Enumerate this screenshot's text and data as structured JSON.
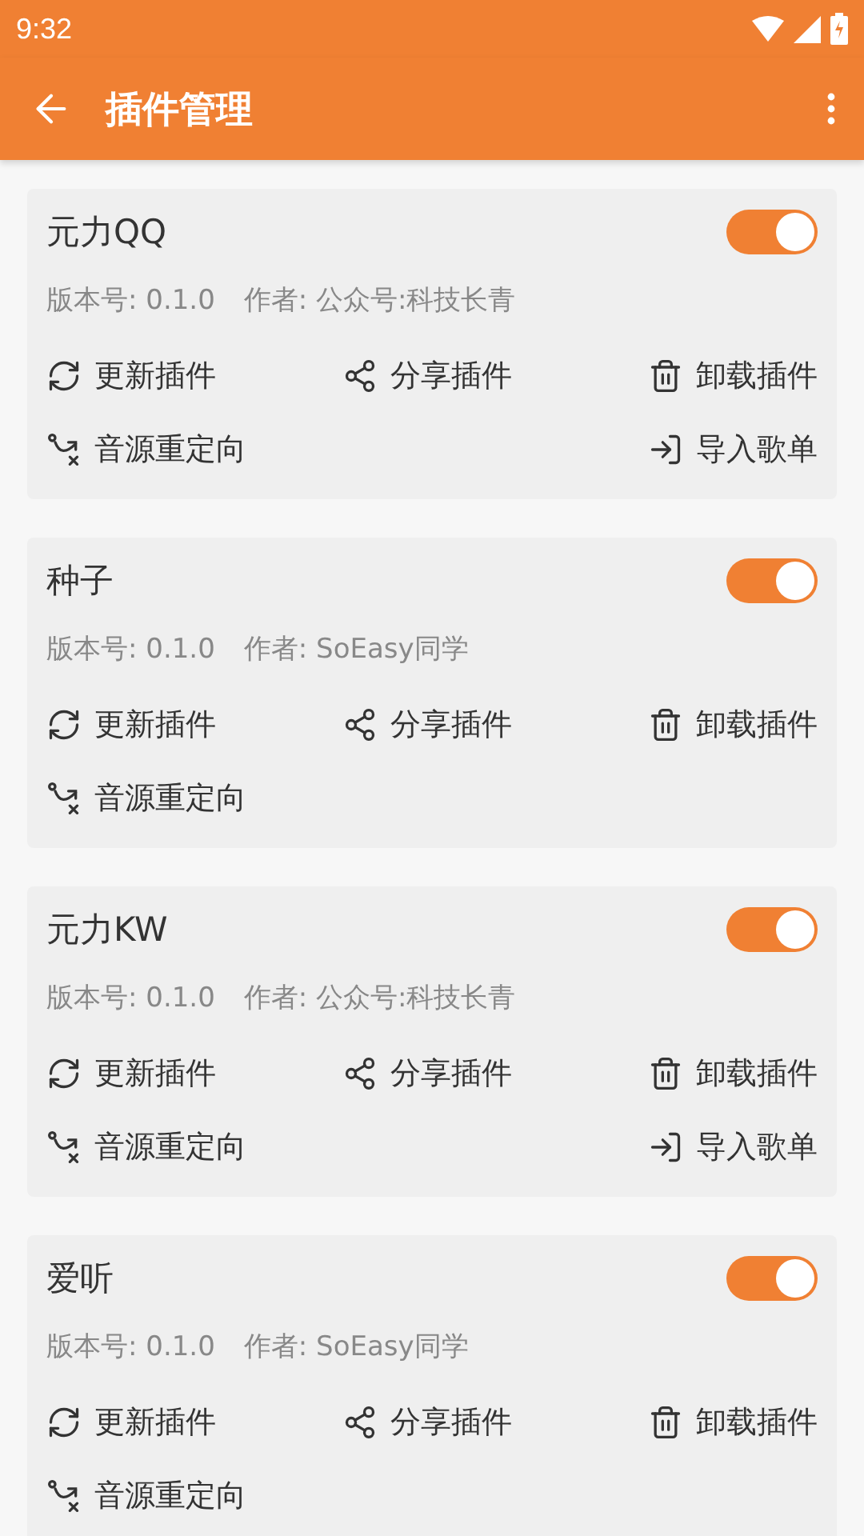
{
  "status_bar": {
    "time": "9:32"
  },
  "app_bar": {
    "title": "插件管理"
  },
  "plugins": [
    {
      "name": "元力QQ",
      "enabled": true,
      "version": "版本号: 0.1.0",
      "author": "作者: 公众号:科技长青",
      "actions": [
        {
          "kind": "update",
          "label": "更新插件"
        },
        {
          "kind": "share",
          "label": "分享插件"
        },
        {
          "kind": "uninstall",
          "label": "卸载插件"
        },
        {
          "kind": "redirect",
          "label": "音源重定向"
        },
        {
          "kind": "import",
          "label": "导入歌单"
        }
      ]
    },
    {
      "name": "种子",
      "enabled": true,
      "version": "版本号: 0.1.0",
      "author": "作者: SoEasy同学",
      "actions": [
        {
          "kind": "update",
          "label": "更新插件"
        },
        {
          "kind": "share",
          "label": "分享插件"
        },
        {
          "kind": "uninstall",
          "label": "卸载插件"
        },
        {
          "kind": "redirect",
          "label": "音源重定向"
        }
      ]
    },
    {
      "name": "元力KW",
      "enabled": true,
      "version": "版本号: 0.1.0",
      "author": "作者: 公众号:科技长青",
      "actions": [
        {
          "kind": "update",
          "label": "更新插件"
        },
        {
          "kind": "share",
          "label": "分享插件"
        },
        {
          "kind": "uninstall",
          "label": "卸载插件"
        },
        {
          "kind": "redirect",
          "label": "音源重定向"
        },
        {
          "kind": "import",
          "label": "导入歌单"
        }
      ]
    },
    {
      "name": "爱听",
      "enabled": true,
      "version": "版本号: 0.1.0",
      "author": "作者: SoEasy同学",
      "actions": [
        {
          "kind": "update",
          "label": "更新插件"
        },
        {
          "kind": "share",
          "label": "分享插件"
        },
        {
          "kind": "uninstall",
          "label": "卸载插件"
        },
        {
          "kind": "redirect",
          "label": "音源重定向"
        }
      ]
    }
  ]
}
